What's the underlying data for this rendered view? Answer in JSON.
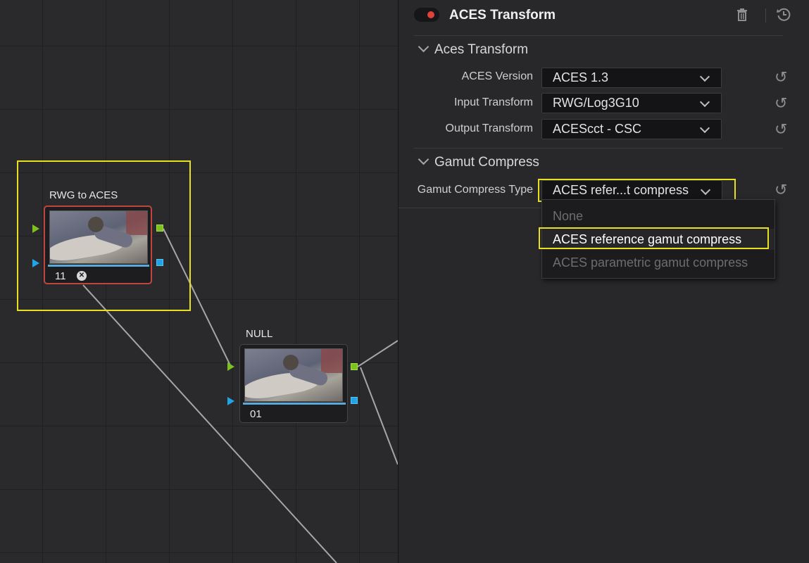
{
  "graph": {
    "nodes": [
      {
        "label": "RWG to ACES",
        "number": "11",
        "selected": true,
        "fx_icon": "resolve-fx-icon"
      },
      {
        "label": "NULL",
        "number": "01",
        "selected": false
      }
    ]
  },
  "panel": {
    "title": "ACES Transform",
    "enabled": true,
    "sections": {
      "aces_transform": {
        "header": "Aces Transform",
        "rows": [
          {
            "label": "ACES Version",
            "value": "ACES 1.3"
          },
          {
            "label": "Input Transform",
            "value": "RWG/Log3G10"
          },
          {
            "label": "Output Transform",
            "value": "ACEScct - CSC"
          }
        ]
      },
      "gamut_compress": {
        "header": "Gamut Compress",
        "row": {
          "label": "Gamut Compress Type",
          "value": "ACES refer...t compress"
        },
        "options": [
          {
            "label": "None",
            "state": "disabled"
          },
          {
            "label": "ACES reference gamut compress",
            "state": "selected"
          },
          {
            "label": "ACES parametric gamut compress",
            "state": "disabled"
          }
        ]
      }
    }
  },
  "colors": {
    "highlight": "#e8e01c",
    "toggle_on": "#e0413a",
    "port_output": "#7dc11f",
    "port_key": "#21a4e6",
    "selected_node_border": "#c0453f"
  }
}
